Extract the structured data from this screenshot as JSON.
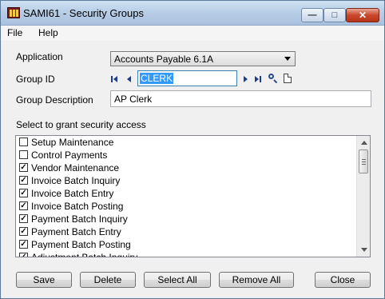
{
  "window": {
    "title": "SAMI61 - Security Groups",
    "minimize_label": "—",
    "maximize_label": "□",
    "close_label": "✕"
  },
  "menu": {
    "file": "File",
    "help": "Help"
  },
  "form": {
    "application_label": "Application",
    "application_value": "Accounts Payable 6.1A",
    "group_id_label": "Group ID",
    "group_id_value": "CLERK",
    "group_description_label": "Group Description",
    "group_description_value": "AP Clerk",
    "access_label": "Select to grant security access"
  },
  "access_list": [
    {
      "label": "Setup Maintenance",
      "checked": false
    },
    {
      "label": "Control Payments",
      "checked": false
    },
    {
      "label": "Vendor Maintenance",
      "checked": true
    },
    {
      "label": "Invoice Batch Inquiry",
      "checked": true
    },
    {
      "label": "Invoice Batch Entry",
      "checked": true
    },
    {
      "label": "Invoice Batch Posting",
      "checked": true
    },
    {
      "label": "Payment Batch Inquiry",
      "checked": true
    },
    {
      "label": "Payment Batch Entry",
      "checked": true
    },
    {
      "label": "Payment Batch Posting",
      "checked": true
    },
    {
      "label": "Adjustment Batch Inquiry",
      "checked": true
    }
  ],
  "buttons": {
    "save": "Save",
    "delete": "Delete",
    "select_all": "Select All",
    "remove_all": "Remove All",
    "close": "Close"
  },
  "icons": {
    "app": "app-icon",
    "first": "first-record-icon",
    "previous": "previous-record-icon",
    "next": "next-record-icon",
    "last": "last-record-icon",
    "finder": "magnifier-icon",
    "new": "new-document-icon"
  },
  "colors": {
    "title_bar": "#b7cde6",
    "selection": "#3399ff",
    "close_button": "#c9482d",
    "nav_arrows": "#1b3d8c"
  }
}
